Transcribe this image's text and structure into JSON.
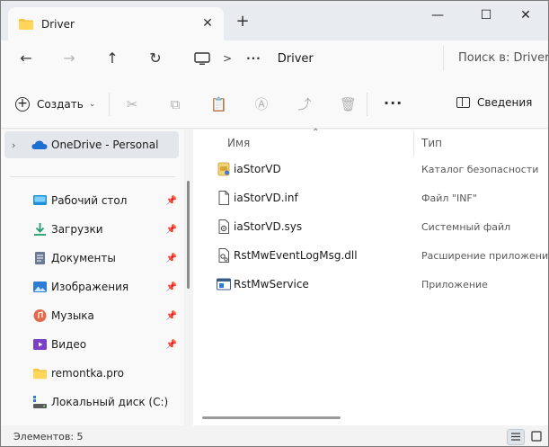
{
  "window": {
    "tab_title": "Driver",
    "new_tab": "+",
    "minimize": "—",
    "maximize": "☐",
    "close": "✕",
    "tab_close": "✕"
  },
  "nav": {
    "back": "←",
    "forward": "→",
    "up": "↑",
    "refresh": "↻",
    "separator": ">",
    "more": "···",
    "crumb": "Driver",
    "search_placeholder": "Поиск в: Driver"
  },
  "toolbar": {
    "create_label": "Создать",
    "more_label": "···",
    "details_label": "Сведения"
  },
  "sidebar": {
    "items": [
      {
        "label": "OneDrive - Personal",
        "icon": "onedrive-icon",
        "selected": true
      },
      {
        "label": "Рабочий стол",
        "icon": "desktop-icon",
        "pinned": true
      },
      {
        "label": "Загрузки",
        "icon": "download-icon",
        "pinned": true
      },
      {
        "label": "Документы",
        "icon": "documents-icon",
        "pinned": true
      },
      {
        "label": "Изображения",
        "icon": "pictures-icon",
        "pinned": true
      },
      {
        "label": "Музыка",
        "icon": "music-icon",
        "pinned": true
      },
      {
        "label": "Видео",
        "icon": "video-icon",
        "pinned": true
      },
      {
        "label": "remontka.pro",
        "icon": "folder-icon"
      },
      {
        "label": "Локальный диск (C:)",
        "icon": "drive-icon"
      }
    ]
  },
  "columns": {
    "name": "Имя",
    "type": "Тип"
  },
  "files": [
    {
      "name": "iaStorVD",
      "type": "Каталог безопасности",
      "icon": "security-catalog-icon"
    },
    {
      "name": "iaStorVD.inf",
      "type": "Файл \"INF\"",
      "icon": "document-icon"
    },
    {
      "name": "iaStorVD.sys",
      "type": "Системный файл",
      "icon": "system-file-icon"
    },
    {
      "name": "RstMwEventLogMsg.dll",
      "type": "Расширение приложения",
      "icon": "dll-icon"
    },
    {
      "name": "RstMwService",
      "type": "Приложение",
      "icon": "application-icon"
    }
  ],
  "status": {
    "count_text": "Элементов: 5"
  },
  "colors": {
    "folder": "#f4c542",
    "onedrive": "#1f6fd1",
    "accent": "#0067c0"
  }
}
